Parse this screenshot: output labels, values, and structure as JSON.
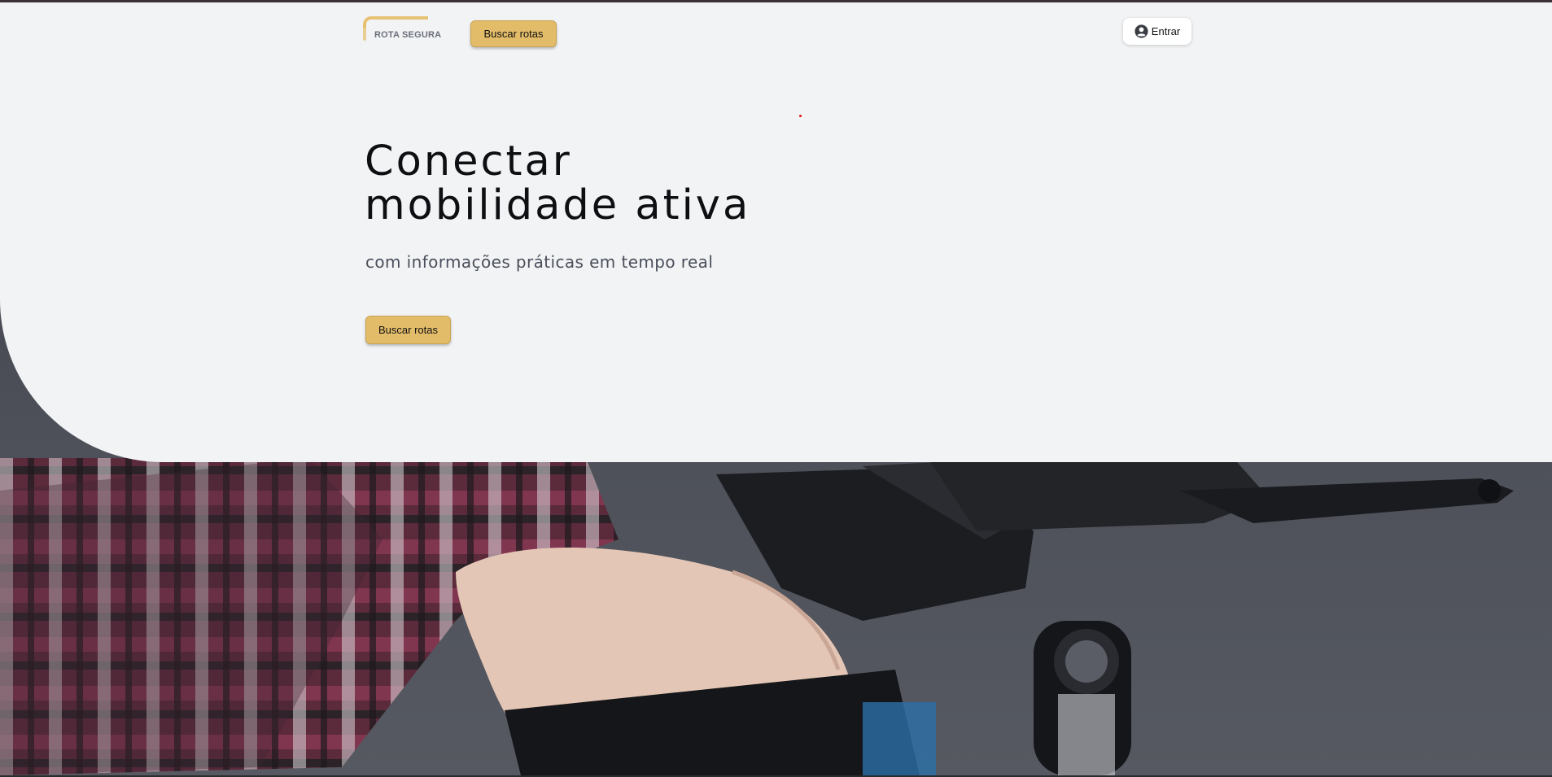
{
  "header": {
    "logo_text": "ROTA SEGURA",
    "search_button_label": "Buscar rotas",
    "login_button_label": "Entrar",
    "login_icon": "user-circle-icon"
  },
  "hero": {
    "title_line1": "Conectar",
    "title_line2": "mobilidade ativa",
    "subtitle": "com informações práticas em tempo real",
    "cta_label": "Buscar rotas"
  },
  "colors": {
    "accent": "#e3bc6a",
    "panel": "#f2f3f5",
    "text": "#0e0f12"
  }
}
